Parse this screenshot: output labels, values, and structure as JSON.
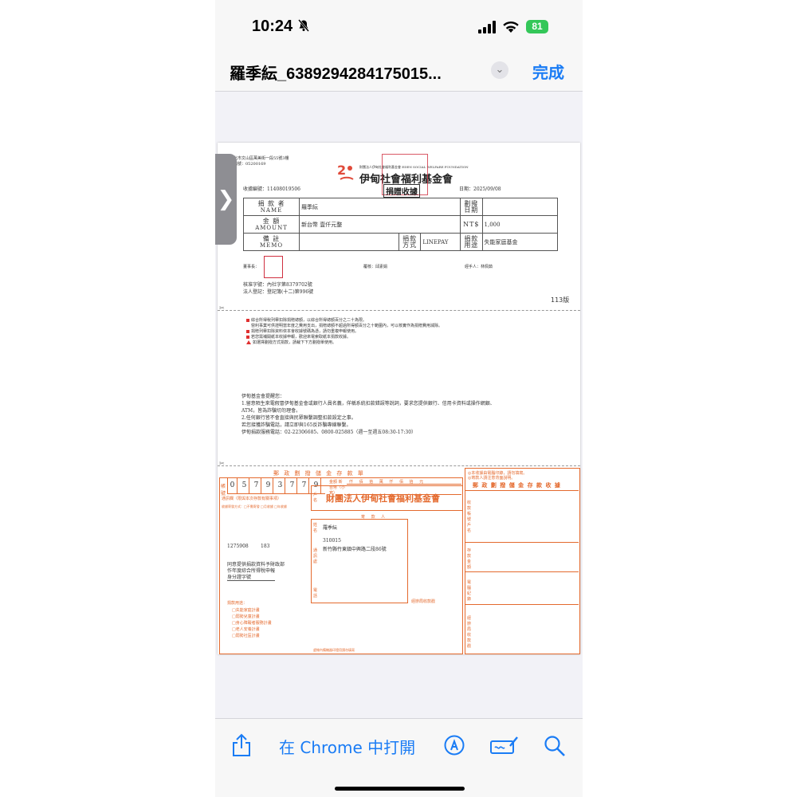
{
  "status_bar": {
    "time": "10:24",
    "battery": "81"
  },
  "title_bar": {
    "filename": "羅季紜_6389294284175015...",
    "done_label": "完成"
  },
  "toolbar": {
    "open_in_chrome": "在 Chrome 中打開"
  },
  "icons": [
    "mute-bell-icon",
    "signal-icon",
    "wifi-icon",
    "chevron-down-icon",
    "sidebar-toggle-icon",
    "share-icon",
    "markup-icon",
    "signature-icon",
    "search-icon"
  ],
  "colors": {
    "accent": "#1a7cf5",
    "battery": "#34c759",
    "form_orange": "#e46a2e",
    "stamp_red": "#d03040"
  },
  "receipt": {
    "address": "台北市文山區萬美街一段55號3樓",
    "tax_id": "統編號：05200169",
    "org_small": "財團法人伊甸社會福利基金會 EDEN SOCIAL WELFARE FOUNDATION",
    "org_name": "伊甸社會福利基金會",
    "title": "捐贈收據",
    "receipt_no": "收據編號：11408019506",
    "date": "日期：2025/09/08",
    "donor_label": "捐 款 者",
    "donor_label_en": "NAME",
    "donor_name": "羅季紜",
    "transfer_date_label": "劃撥日期",
    "amount_label": "金 額",
    "amount_label_en": "AMOUNT",
    "amount_text": "新台幣 壹仟元整",
    "currency_label": "NT$",
    "amount_value": "1,000",
    "memo_label": "備 註",
    "memo_label_en": "MEMO",
    "method_label": "捐款方式",
    "method_value": "LINEPAY",
    "purpose_label": "捐款用途",
    "purpose_value": "失能家庭基金",
    "chairman_label": "董事長：",
    "accountant": "覆核：邱素娟",
    "handler": "經手人：林佩茹",
    "approval_no": "核准字號：內社字第8379702號",
    "registration": "法人登記：登記簿(十二)第996號",
    "version": "113版",
    "notes": [
      "綜合所得稅列舉扣除捐贈總額，以綜合所得總額百分之二十為限。",
      "營利事業可供證明當年度之費用支出，捐贈總額不超過所得額百分之十範圍內，可以核實作為捐贈費用減除。",
      "捐贈列舉扣除資料依本會收據號碼為憑，請勿重複申報使用。",
      "若您需補開紙本收據申報，歡迎來電索取紙本捐款收據。",
      "如選擇劃撥方式捐款，請裁下下方劃撥單使用。"
    ],
    "reminder_title": "伊甸基金會提醒您：",
    "reminders": [
      "1.留意陌生來電假冒伊甸基金會或銀行人員名義，佯稱系統扣款錯誤等說詞，要求您提供銀行、信用卡資料或操作網銀、",
      "ATM，皆為詐騙切勿理會。",
      "2.任何銀行皆不會直接與民眾聯繫調整扣款設定之事。",
      "若您接獲詐騙電話，請立即與165反詐騙專線聯繫。",
      "伊甸捐款服務電話：02-22306685、0800-025885（週一至週五08:30-17:30）"
    ]
  },
  "slip": {
    "header": "郵 政 劃 撥 儲 金 存 款 單",
    "account_label": "帳號",
    "account_digits": [
      "0",
      "5",
      "7",
      "9",
      "3",
      "7",
      "7",
      "9"
    ],
    "amount_header": "仟 佰 拾 萬 仟 佰 拾 元",
    "amount_label": "金額 新台幣（小寫）",
    "notice_top": "◎本收據由電腦印錄，請勿填寫。",
    "notice_top2": "◎寄款人請注意背面說明。",
    "receipt_title": "郵 政 劃 撥 儲 金 存 款 收 據",
    "contact_label": "通訊欄（限與本次存款有關事項）",
    "tax_options": "收據寄發方式：□不需寄發 □月收據 □年收據",
    "payee_label": "戶名",
    "payee_name": "財團法人伊甸社會福利基金會",
    "sender_label": "寄 款 人",
    "name_label": "姓名",
    "addr_label": "通訊處",
    "phone_label": "電話",
    "sender_name": "羅季紜",
    "postal_code": "310015",
    "sender_address": "新竹縣竹東鎮中興路二段86號",
    "code1": "1275908",
    "code2": "183",
    "tax_agree1": "同意提供捐款資料予財政部",
    "tax_agree2": "作年度綜合所得稅申報",
    "id_label": "身分證字號",
    "handler_stamp": "經辦局收款戳",
    "purpose_title": "捐款用途：",
    "purposes": [
      "□失能家庭計畫",
      "□弱勢兒童計畫",
      "□身心障礙者服務計畫",
      "□老人安養計畫",
      "□弱勢社區計畫"
    ],
    "right_labels": [
      "收款帳號戶名",
      "存款金額",
      "電腦紀錄",
      "經辦局收款戳"
    ],
    "footer": "虛線內備機器印證用請勿填寫"
  }
}
